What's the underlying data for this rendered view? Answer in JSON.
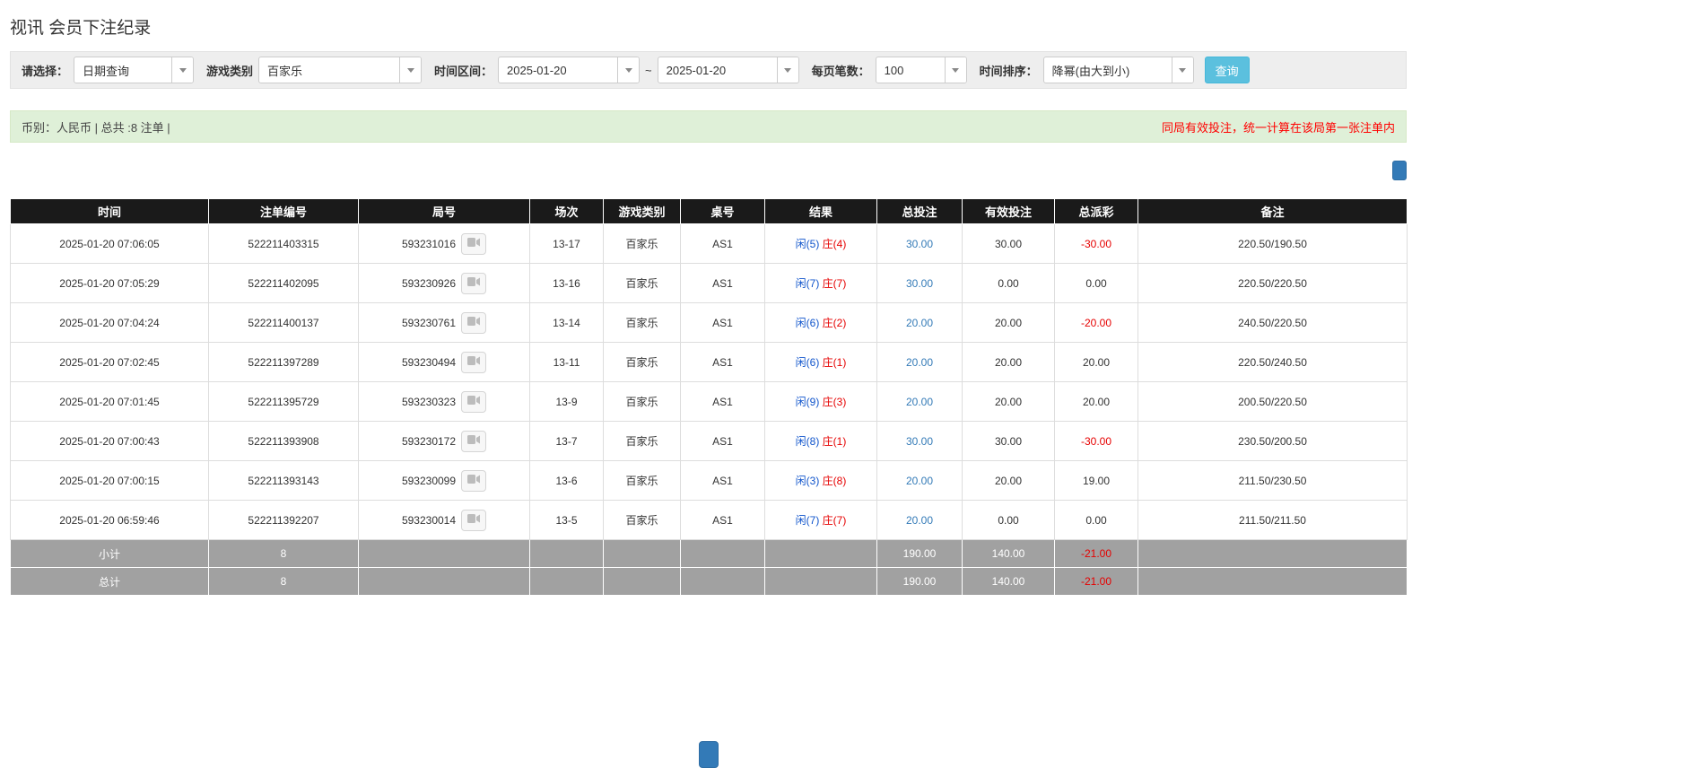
{
  "page": {
    "title": "视讯 会员下注纪录"
  },
  "filter_bar": {
    "select_label": "请选择：",
    "select_value": "日期查询",
    "game_type_label": "游戏类别",
    "game_type_value": "百家乐",
    "time_range_label": "时间区间：",
    "date_from": "2025-01-20",
    "range_separator": "~",
    "date_to": "2025-01-20",
    "per_page_label": "每页笔数：",
    "per_page_value": "100",
    "sort_label": "时间排序：",
    "sort_value": "降幂(由大到小)",
    "query_button_label": "查询"
  },
  "summary_bar": {
    "left_text": "币别：人民币 | 总共 :8 注单 |",
    "right_text": "同局有效投注，统一计算在该局第一张注单内"
  },
  "table": {
    "headers": [
      "时间",
      "注单编号",
      "局号",
      "场次",
      "游戏类别",
      "桌号",
      "结果",
      "总投注",
      "有效投注",
      "总派彩",
      "备注"
    ],
    "rows": [
      {
        "time": "2025-01-20 07:06:05",
        "bet_id": "522211403315",
        "round_id": "593231016",
        "session": "13-17",
        "game_type": "百家乐",
        "table_no": "AS1",
        "result_player": "闲(5)",
        "result_banker": "庄(4)",
        "total_bet": "30.00",
        "valid_bet": "30.00",
        "payout": "-30.00",
        "remark": "220.50/190.50"
      },
      {
        "time": "2025-01-20 07:05:29",
        "bet_id": "522211402095",
        "round_id": "593230926",
        "session": "13-16",
        "game_type": "百家乐",
        "table_no": "AS1",
        "result_player": "闲(7)",
        "result_banker": "庄(7)",
        "total_bet": "30.00",
        "valid_bet": "0.00",
        "payout": "0.00",
        "remark": "220.50/220.50"
      },
      {
        "time": "2025-01-20 07:04:24",
        "bet_id": "522211400137",
        "round_id": "593230761",
        "session": "13-14",
        "game_type": "百家乐",
        "table_no": "AS1",
        "result_player": "闲(6)",
        "result_banker": "庄(2)",
        "total_bet": "20.00",
        "valid_bet": "20.00",
        "payout": "-20.00",
        "remark": "240.50/220.50"
      },
      {
        "time": "2025-01-20 07:02:45",
        "bet_id": "522211397289",
        "round_id": "593230494",
        "session": "13-11",
        "game_type": "百家乐",
        "table_no": "AS1",
        "result_player": "闲(6)",
        "result_banker": "庄(1)",
        "total_bet": "20.00",
        "valid_bet": "20.00",
        "payout": "20.00",
        "remark": "220.50/240.50"
      },
      {
        "time": "2025-01-20 07:01:45",
        "bet_id": "522211395729",
        "round_id": "593230323",
        "session": "13-9",
        "game_type": "百家乐",
        "table_no": "AS1",
        "result_player": "闲(9)",
        "result_banker": "庄(3)",
        "total_bet": "20.00",
        "valid_bet": "20.00",
        "payout": "20.00",
        "remark": "200.50/220.50"
      },
      {
        "time": "2025-01-20 07:00:43",
        "bet_id": "522211393908",
        "round_id": "593230172",
        "session": "13-7",
        "game_type": "百家乐",
        "table_no": "AS1",
        "result_player": "闲(8)",
        "result_banker": "庄(1)",
        "total_bet": "30.00",
        "valid_bet": "30.00",
        "payout": "-30.00",
        "remark": "230.50/200.50"
      },
      {
        "time": "2025-01-20 07:00:15",
        "bet_id": "522211393143",
        "round_id": "593230099",
        "session": "13-6",
        "game_type": "百家乐",
        "table_no": "AS1",
        "result_player": "闲(3)",
        "result_banker": "庄(8)",
        "total_bet": "20.00",
        "valid_bet": "20.00",
        "payout": "19.00",
        "remark": "211.50/230.50"
      },
      {
        "time": "2025-01-20 06:59:46",
        "bet_id": "522211392207",
        "round_id": "593230014",
        "session": "13-5",
        "game_type": "百家乐",
        "table_no": "AS1",
        "result_player": "闲(7)",
        "result_banker": "庄(7)",
        "total_bet": "20.00",
        "valid_bet": "0.00",
        "payout": "0.00",
        "remark": "211.50/211.50"
      }
    ],
    "subtotal_row": {
      "label": "小计",
      "count": "8",
      "total_bet": "190.00",
      "valid_bet": "140.00",
      "payout": "-21.00"
    },
    "total_row": {
      "label": "总计",
      "count": "8",
      "total_bet": "190.00",
      "valid_bet": "140.00",
      "payout": "-21.00"
    }
  },
  "colors": {
    "accent_blue": "#337ab7",
    "query_button_blue": "#5bc0de",
    "player_blue": "#1155cc",
    "banker_red": "#e60000",
    "negative_red": "#e60000",
    "summary_bg_green": "#dff0d8",
    "table_header_bg": "#1a1a1a",
    "table_footer_bg": "#a1a1a1"
  }
}
